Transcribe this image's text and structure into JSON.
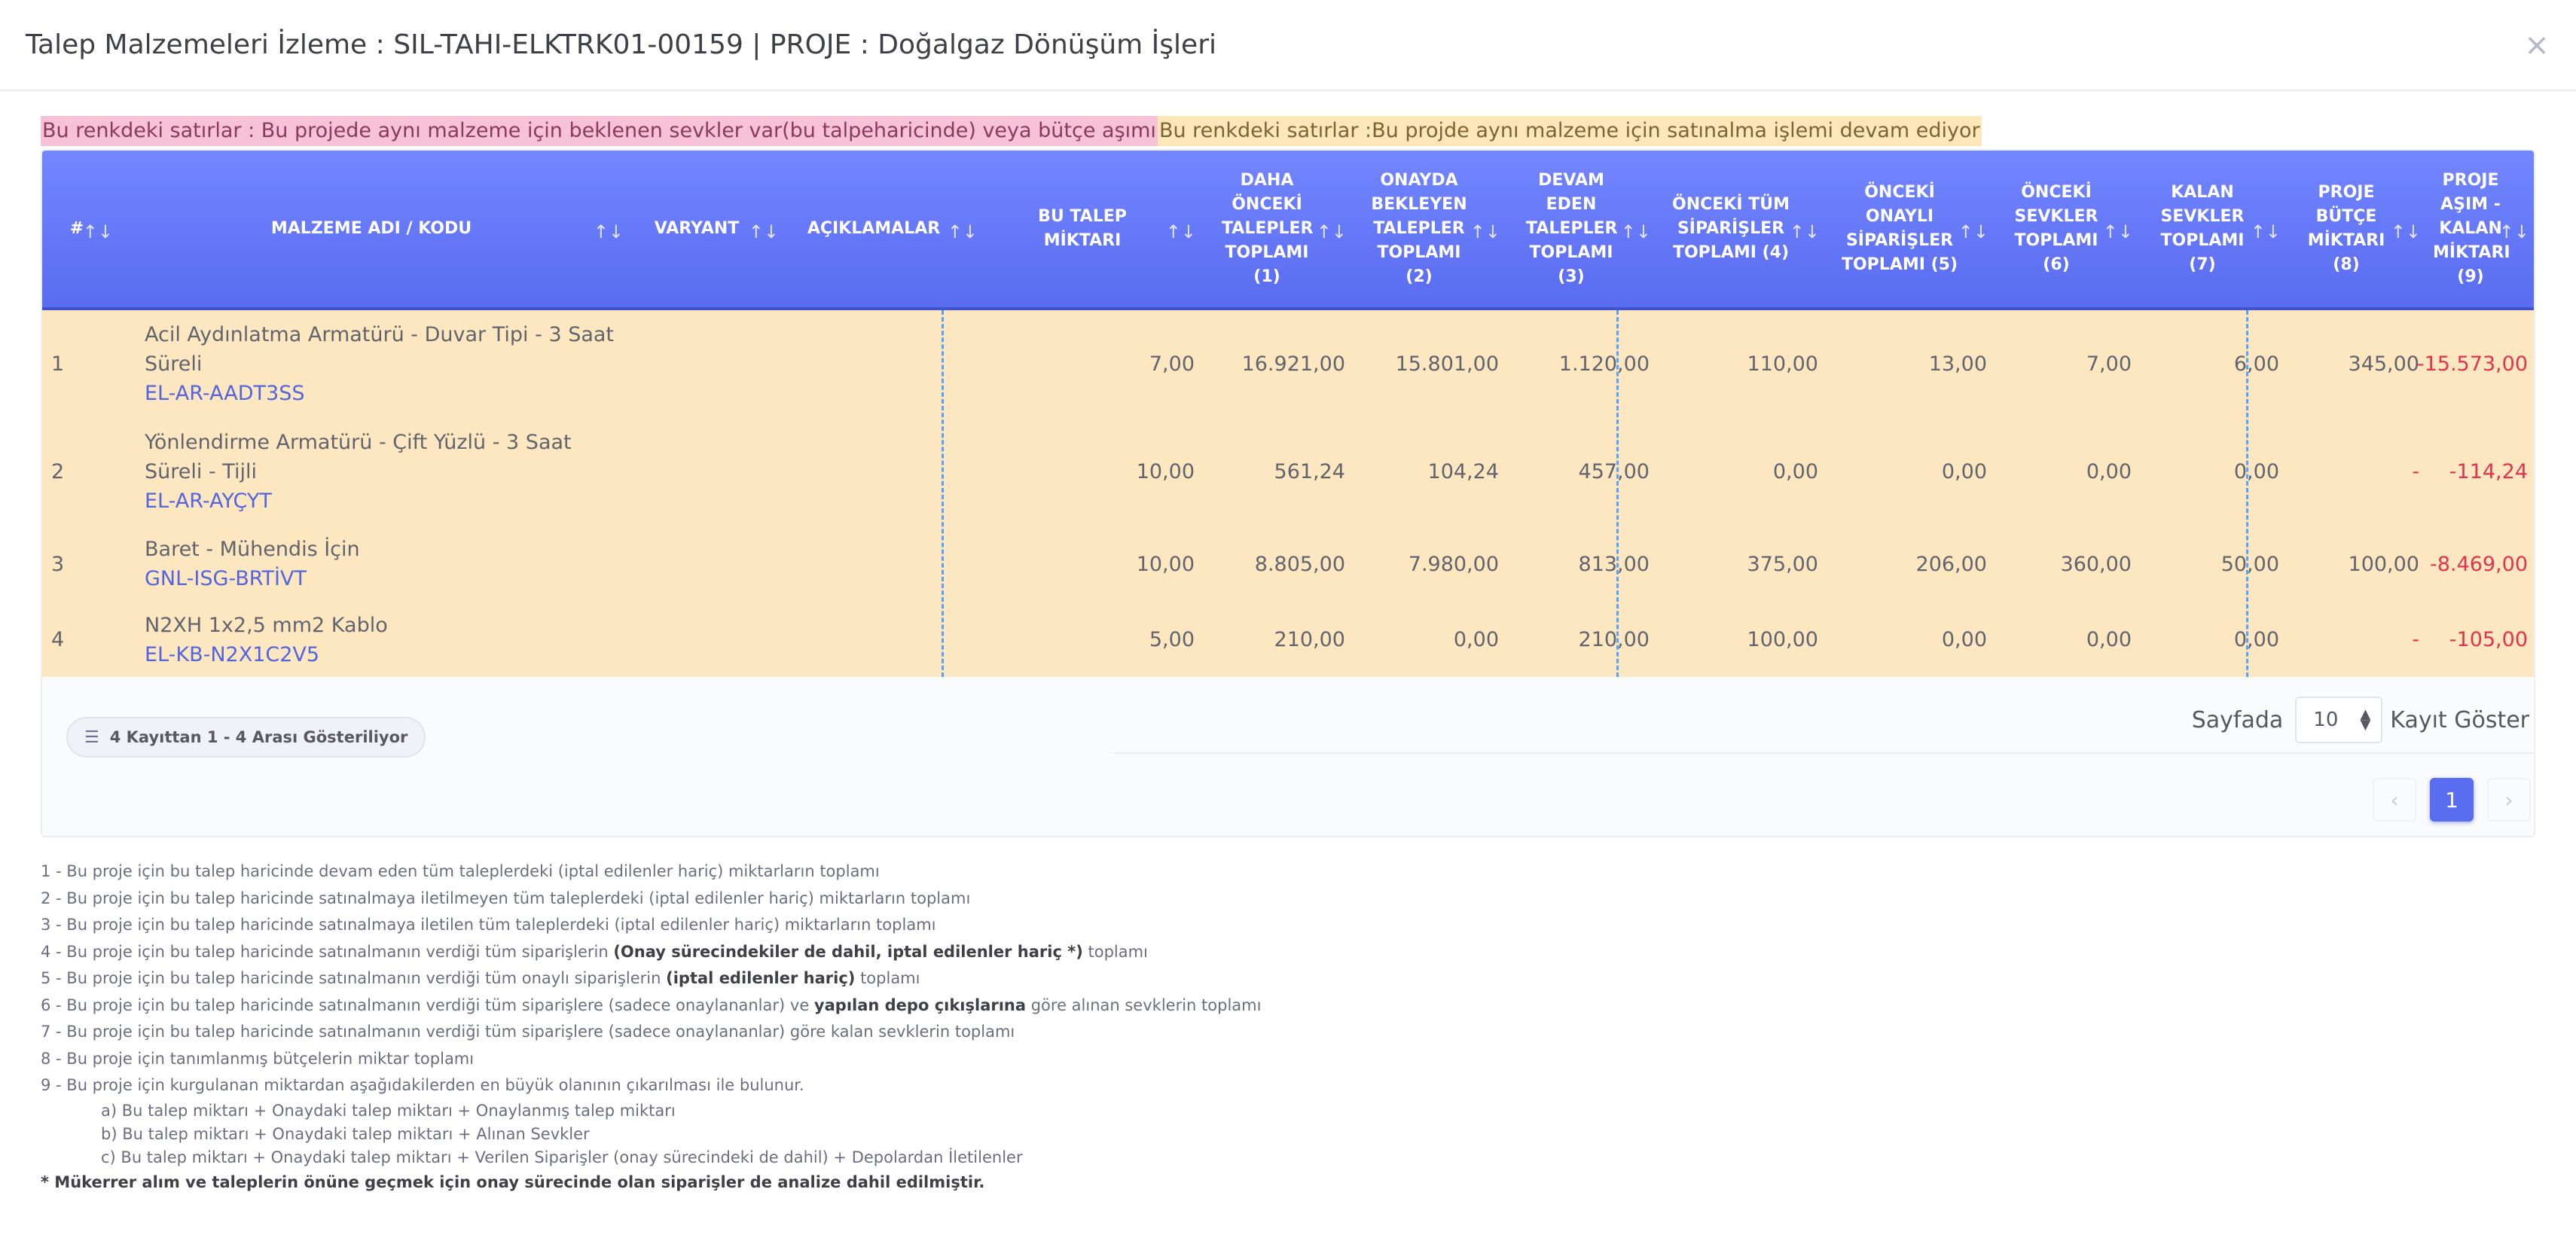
{
  "modal": {
    "title_prefix": "Talep Malzemeleri İzleme : ",
    "title_code": "SIL-TAHI-ELKTRK01-00159",
    "title_project": " | PROJE : Doğalgaz Dönüşüm İşleri",
    "close_icon": "close-icon"
  },
  "legend": {
    "pink": "Bu renkdeki satırlar : Bu projede aynı malzeme için beklenen sevkler var(bu talpeharicinde) veya bütçe aşımı",
    "orange": "Bu renkdeki satırlar :Bu projde aynı malzeme için satınalma işlemi devam ediyor",
    "colors": {
      "pink": "#f7c1d6",
      "orange": "#fde6b8",
      "row": "#fde7c0",
      "header": "#5a6cf0"
    }
  },
  "table": {
    "headers": {
      "no": "#",
      "name": "MALZEME ADI / KODU",
      "variant": "VARYANT",
      "desc": "AÇIKLAMALAR",
      "this_qty": "BU TALEP MİKTARI",
      "prev_total": "DAHA ÖNCEKİ TALEPLER TOPLAMI (1)",
      "pending": "ONAYDA BEKLEYEN TALEPLER TOPLAMI (2)",
      "ongoing": "DEVAM EDEN TALEPLER TOPLAMI (3)",
      "prev_orders": "ÖNCEKİ TÜM SİPARİŞLER TOPLAMI (4)",
      "approved_orders": "ÖNCEKİ ONAYLI SİPARİŞLER TOPLAMI (5)",
      "prev_shipments": "ÖNCEKİ SEVKLER TOPLAMI (6)",
      "remaining": "KALAN SEVKLER TOPLAMI (7)",
      "budget": "PROJE BÜTÇE MİKTARI (8)",
      "overrun": "PROJE AŞIM - KALAN MİKTARI (9)"
    },
    "sort_icon": "sort-icon",
    "rows": [
      {
        "no": "1",
        "name": "Acil Aydınlatma Armatürü - Duvar Tipi - 3 Saat Süreli",
        "code": "EL-AR-AADT3SS",
        "this_qty": "7,00",
        "prev_total": "16.921,00",
        "pending": "15.801,00",
        "ongoing": "1.120,00",
        "prev_orders": "110,00",
        "approved_orders": "13,00",
        "prev_shipments": "7,00",
        "remaining": "6,00",
        "budget": "345,00",
        "overrun": "-15.573,00"
      },
      {
        "no": "2",
        "name": "Yönlendirme Armatürü - Çift Yüzlü - 3 Saat Süreli - Tijli",
        "code": "EL-AR-AYÇYT",
        "this_qty": "10,00",
        "prev_total": "561,24",
        "pending": "104,24",
        "ongoing": "457,00",
        "prev_orders": "0,00",
        "approved_orders": "0,00",
        "prev_shipments": "0,00",
        "remaining": "0,00",
        "budget": "-",
        "overrun": "-114,24"
      },
      {
        "no": "3",
        "name": "Baret - Mühendis İçin",
        "code": "GNL-ISG-BRTİVT",
        "this_qty": "10,00",
        "prev_total": "8.805,00",
        "pending": "7.980,00",
        "ongoing": "813,00",
        "prev_orders": "375,00",
        "approved_orders": "206,00",
        "prev_shipments": "360,00",
        "remaining": "50,00",
        "budget": "100,00",
        "overrun": "-8.469,00"
      },
      {
        "no": "4",
        "name": "N2XH 1x2,5 mm2 Kablo",
        "code": "EL-KB-N2X1C2V5",
        "this_qty": "5,00",
        "prev_total": "210,00",
        "pending": "0,00",
        "ongoing": "210,00",
        "prev_orders": "100,00",
        "approved_orders": "0,00",
        "prev_shipments": "0,00",
        "remaining": "0,00",
        "budget": "-",
        "overrun": "-105,00"
      }
    ]
  },
  "footer": {
    "info": "4 Kayıttan 1 - 4 Arası Gösteriliyor",
    "list_icon": "list-icon",
    "page_size_label": "Sayfada",
    "page_size_value": "10",
    "page_size_suffix": "Kayıt Göster",
    "pages": [
      "1"
    ],
    "current_page": "1",
    "prev_icon": "chevron-left-icon",
    "next_icon": "chevron-right-icon"
  },
  "notes": {
    "n1": "1 - Bu proje için bu talep haricinde devam eden tüm taleplerdeki (iptal edilenler hariç) miktarların toplamı",
    "n2": "2 - Bu proje için bu talep haricinde satınalmaya iletilmeyen tüm taleplerdeki (iptal edilenler hariç) miktarların toplamı",
    "n3": "3 - Bu proje için bu talep haricinde satınalmaya iletilen tüm taleplerdeki (iptal edilenler hariç) miktarların toplamı",
    "n4_a": "4 - Bu proje için bu talep haricinde satınalmanın verdiği tüm siparişlerin ",
    "n4_b": "(Onay sürecindekiler de dahil, iptal edilenler hariç *)",
    "n4_c": " toplamı",
    "n5_a": "5 - Bu proje için bu talep haricinde satınalmanın verdiği tüm onaylı siparişlerin ",
    "n5_b": "(iptal edilenler hariç)",
    "n5_c": " toplamı",
    "n6_a": "6 - Bu proje için bu talep haricinde satınalmanın verdiği tüm siparişlere (sadece onaylananlar) ve ",
    "n6_b": "yapılan depo çıkışlarına",
    "n6_c": " göre alınan sevklerin toplamı",
    "n7": "7 - Bu proje için bu talep haricinde satınalmanın verdiği tüm siparişlere (sadece onaylananlar) göre kalan sevklerin toplamı",
    "n8": "8 - Bu proje için tanımlanmış bütçelerin miktar toplamı",
    "n9": "9 - Bu proje için kurgulanan miktardan aşağıdakilerden en büyük olanının çıkarılması ile bulunur.",
    "n9a": "a) Bu talep miktarı + Onaydaki talep miktarı + Onaylanmış talep miktarı",
    "n9b": "b) Bu talep miktarı + Onaydaki talep miktarı + Alınan Sevkler",
    "n9c": "c) Bu talep miktarı + Onaydaki talep miktarı + Verilen Siparişler (onay sürecindeki de dahil) + Depolardan İletilenler",
    "final": "* Mükerrer alım ve taleplerin önüne geçmek için onay sürecinde olan siparişler de analize dahil edilmiştir."
  }
}
